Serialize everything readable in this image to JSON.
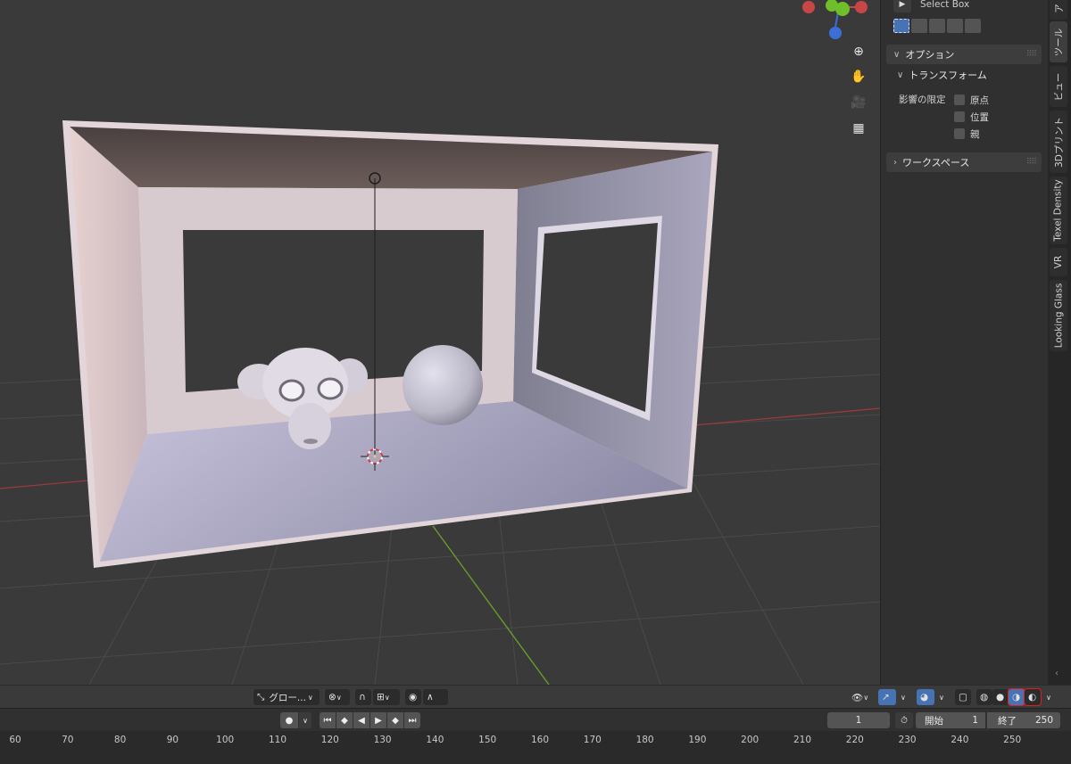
{
  "npanel": {
    "tool_name": "Select Box",
    "options_header": "オプション",
    "transform_subheader": "トランスフォーム",
    "affect_only_label": "影響の限定",
    "checkbox_origin": "原点",
    "checkbox_location": "位置",
    "checkbox_parent": "親",
    "workspace_header": "ワークスペース"
  },
  "side_tabs": {
    "item": "ア",
    "tool": "ツール",
    "view": "ビュー",
    "print3d": "3Dプリント",
    "texel_density": "Texel Density",
    "vr": "VR",
    "looking_glass": "Looking Glass"
  },
  "header": {
    "orientation_label": "グロー..."
  },
  "timeline": {
    "current_frame": "1",
    "start_label": "開始",
    "start_value": "1",
    "end_label": "終了",
    "end_value": "250"
  },
  "ruler": {
    "ticks": [
      "60",
      "70",
      "80",
      "90",
      "100",
      "110",
      "120",
      "130",
      "140",
      "150",
      "160",
      "170",
      "180",
      "190",
      "200",
      "210",
      "220",
      "230",
      "240",
      "250"
    ]
  },
  "annotation": {
    "arrow_color": "#e01e1e",
    "target": "shading-rendered"
  },
  "colors": {
    "axis_x": "#e74c4c",
    "axis_y": "#6fbf2a",
    "axis_z": "#3b6fd6",
    "selection_blue": "#4772b3"
  }
}
